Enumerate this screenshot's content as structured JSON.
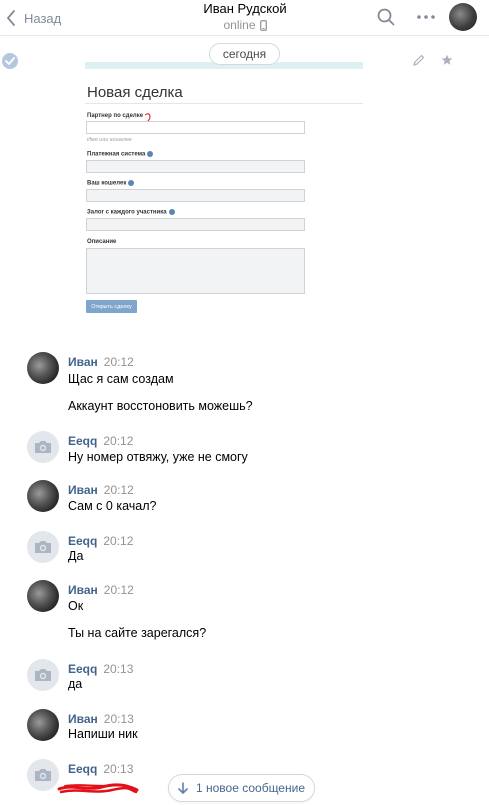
{
  "header": {
    "back_label": "Назад",
    "contact_name": "Иван Рудской",
    "status": "online"
  },
  "day_divider": "сегодня",
  "attachment": {
    "title": "Новая сделка",
    "fields": {
      "partner_label": "Партнер по сделке",
      "partner_hint": "Имя или кошелек",
      "payment_label": "Платежная система",
      "wallet_label": "Ваш кошелек",
      "deposit_label": "Залог с каждого участника",
      "description_label": "Описание"
    },
    "button_label": "Открыть сделку"
  },
  "messages": [
    {
      "author": "Иван",
      "time": "20:12",
      "texts": [
        "Щас я сам создам",
        "Аккаунт восстоновить можешь?"
      ]
    },
    {
      "author": "Eeqq",
      "time": "20:12",
      "texts": [
        "Ну номер отвяжу, уже не смогу"
      ]
    },
    {
      "author": "Иван",
      "time": "20:12",
      "texts": [
        "Сам с 0 качал?"
      ]
    },
    {
      "author": "Eeqq",
      "time": "20:12",
      "texts": [
        "Да"
      ]
    },
    {
      "author": "Иван",
      "time": "20:12",
      "texts": [
        "Ок",
        "Ты на сайте зарегался?"
      ]
    },
    {
      "author": "Eeqq",
      "time": "20:13",
      "texts": [
        "да"
      ]
    },
    {
      "author": "Иван",
      "time": "20:13",
      "texts": [
        "Напиши ник"
      ]
    },
    {
      "author": "Eeqq",
      "time": "20:13",
      "texts": []
    }
  ],
  "new_messages_label": "1 новое сообщение",
  "colors": {
    "accent": "#42648b",
    "link_blue": "#45678f",
    "muted": "#939393",
    "redaction": "#e3101a"
  },
  "icons": {
    "back": "chevron-left-icon",
    "search": "search-icon",
    "more": "more-dots-icon",
    "phone": "mobile-phone-icon",
    "edit": "pencil-icon",
    "favorite": "star-icon",
    "camera": "camera-icon",
    "arrow_down": "arrow-down-icon"
  }
}
